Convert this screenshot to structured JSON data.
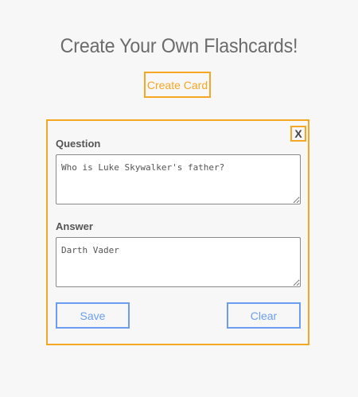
{
  "page": {
    "title": "Create Your Own Flashcards!",
    "create_card_label": "Create Card"
  },
  "modal": {
    "close_label": "X",
    "question": {
      "label": "Question",
      "value": "Who is Luke Skywalker's father?"
    },
    "answer": {
      "label": "Answer",
      "value": "Darth Vader"
    },
    "save_label": "Save",
    "clear_label": "Clear"
  },
  "colors": {
    "accent_orange": "#f5a623",
    "accent_blue": "#6b9ef0",
    "background": "#f7f7f7",
    "title_text": "#6b6b6b"
  }
}
